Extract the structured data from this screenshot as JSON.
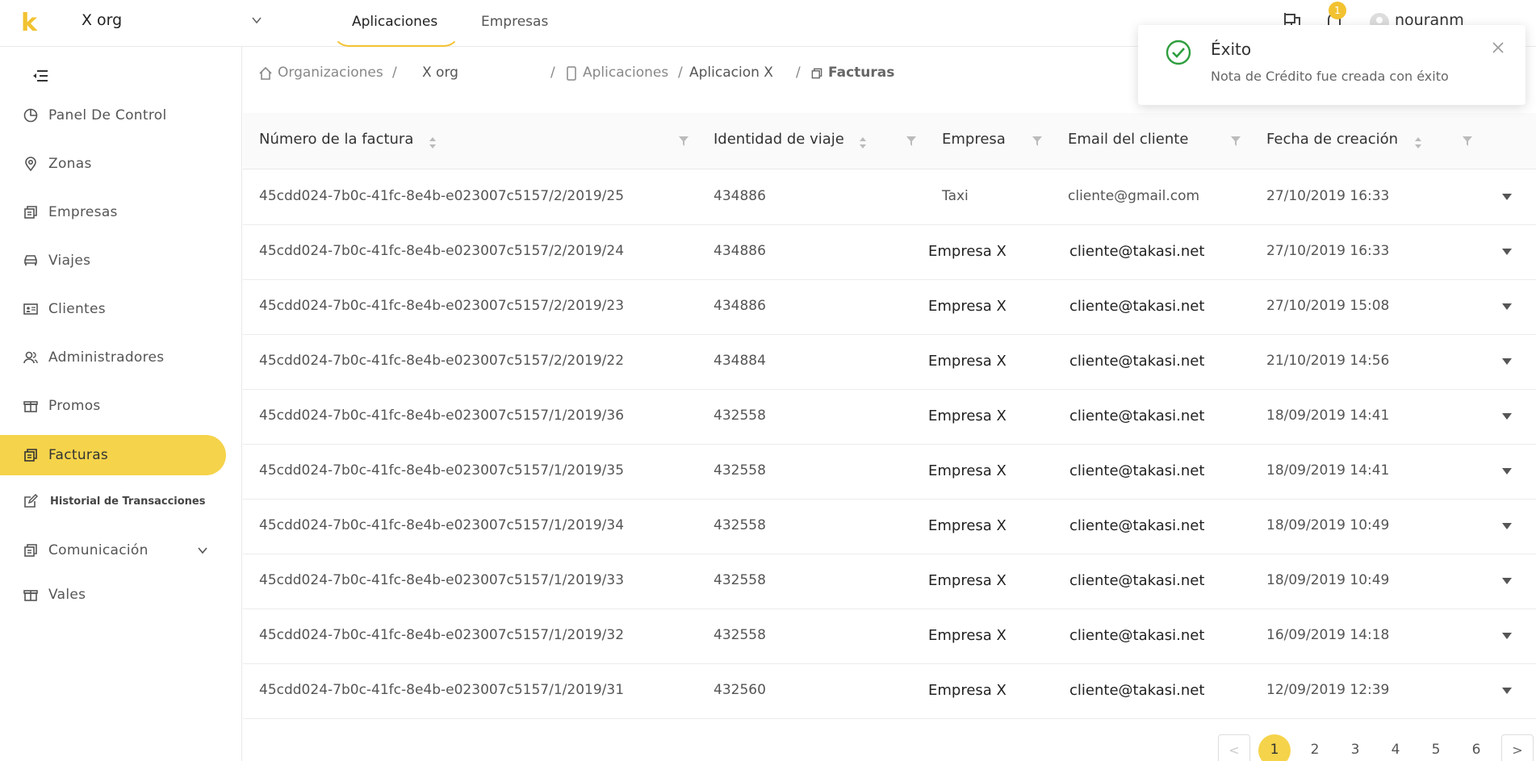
{
  "topbar": {
    "logo": "k",
    "org_name": "X org",
    "tabs": [
      {
        "label": "Aplicaciones"
      },
      {
        "label": "Empresas"
      }
    ],
    "notification_count": "1",
    "user_name": "nouranm"
  },
  "sidebar": {
    "items": [
      {
        "label": "Panel De Control",
        "icon": "pie-chart-icon"
      },
      {
        "label": "Zonas",
        "icon": "location-pin-icon"
      },
      {
        "label": "Empresas",
        "icon": "building-icon"
      },
      {
        "label": "Viajes",
        "icon": "car-icon"
      },
      {
        "label": "Clientes",
        "icon": "id-card-icon"
      },
      {
        "label": "Administradores",
        "icon": "users-icon"
      },
      {
        "label": "Promos",
        "icon": "gift-icon"
      },
      {
        "label": "Facturas",
        "icon": "invoice-icon"
      },
      {
        "label": "Historial de Transacciones",
        "icon": "edit-icon"
      },
      {
        "label": "Comunicación",
        "icon": "communication-icon"
      },
      {
        "label": "Vales",
        "icon": "gift-icon"
      }
    ]
  },
  "breadcrumb": {
    "organizations": "Organizaciones",
    "org": "X org",
    "applications": "Aplicaciones",
    "app": "Aplicacion X",
    "current": "Facturas"
  },
  "table": {
    "headers": [
      "Número de la factura",
      "Identidad de viaje",
      "Empresa",
      "Email del cliente",
      "Fecha de creación"
    ],
    "rows": [
      {
        "invoice": "45cdd024-7b0c-41fc-8e4b-e023007c5157/2/2019/25",
        "trip": "434886",
        "company": "Taxi",
        "email": "cliente@gmail.com",
        "date": "27/10/2019 16:33"
      },
      {
        "invoice": "45cdd024-7b0c-41fc-8e4b-e023007c5157/2/2019/24",
        "trip": "434886",
        "company": "Empresa X",
        "email": "cliente@takasi.net",
        "date": "27/10/2019 16:33"
      },
      {
        "invoice": "45cdd024-7b0c-41fc-8e4b-e023007c5157/2/2019/23",
        "trip": "434886",
        "company": "Empresa X",
        "email": "cliente@takasi.net",
        "date": "27/10/2019 15:08"
      },
      {
        "invoice": "45cdd024-7b0c-41fc-8e4b-e023007c5157/2/2019/22",
        "trip": "434884",
        "company": "Empresa X",
        "email": "cliente@takasi.net",
        "date": "21/10/2019 14:56"
      },
      {
        "invoice": "45cdd024-7b0c-41fc-8e4b-e023007c5157/1/2019/36",
        "trip": "432558",
        "company": "Empresa X",
        "email": "cliente@takasi.net",
        "date": "18/09/2019 14:41"
      },
      {
        "invoice": "45cdd024-7b0c-41fc-8e4b-e023007c5157/1/2019/35",
        "trip": "432558",
        "company": "Empresa X",
        "email": "cliente@takasi.net",
        "date": "18/09/2019 14:41"
      },
      {
        "invoice": "45cdd024-7b0c-41fc-8e4b-e023007c5157/1/2019/34",
        "trip": "432558",
        "company": "Empresa X",
        "email": "cliente@takasi.net",
        "date": "18/09/2019 10:49"
      },
      {
        "invoice": "45cdd024-7b0c-41fc-8e4b-e023007c5157/1/2019/33",
        "trip": "432558",
        "company": "Empresa X",
        "email": "cliente@takasi.net",
        "date": "18/09/2019 10:49"
      },
      {
        "invoice": "45cdd024-7b0c-41fc-8e4b-e023007c5157/1/2019/32",
        "trip": "432558",
        "company": "Empresa X",
        "email": "cliente@takasi.net",
        "date": "16/09/2019 14:18"
      },
      {
        "invoice": "45cdd024-7b0c-41fc-8e4b-e023007c5157/1/2019/31",
        "trip": "432560",
        "company": "Empresa X",
        "email": "cliente@takasi.net",
        "date": "12/09/2019 12:39"
      }
    ]
  },
  "pagination": {
    "prev": "<",
    "next": ">",
    "pages": [
      "1",
      "2",
      "3",
      "4",
      "5",
      "6"
    ],
    "current": "1"
  },
  "toast": {
    "title": "Éxito",
    "message": "Nota de Crédito fue creada con éxito"
  },
  "colors": {
    "accent": "#f5d34a",
    "success": "#2e9e3e"
  }
}
